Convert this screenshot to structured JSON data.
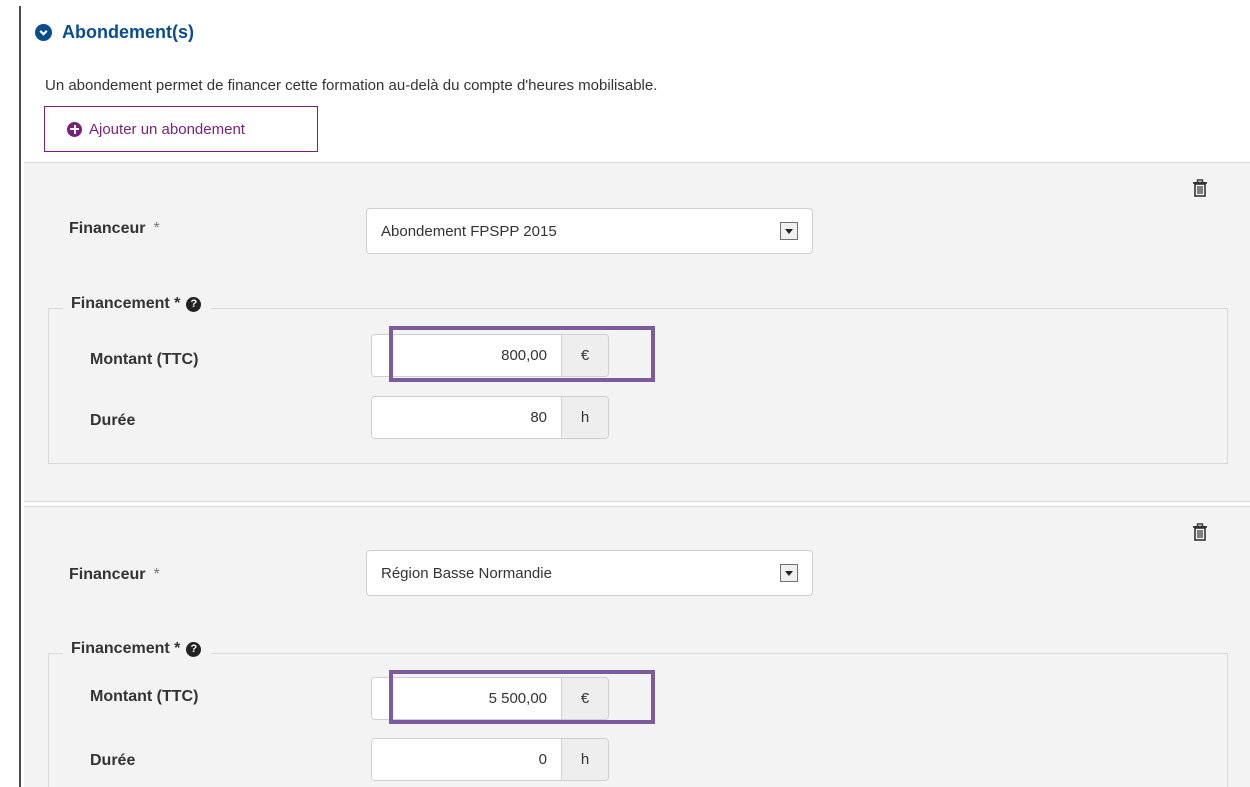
{
  "section": {
    "title": "Abondement(s)",
    "intro": "Un abondement permet de financer cette formation au-delà du compte d'heures mobilisable.",
    "add_label": "Ajouter un abondement"
  },
  "labels": {
    "financeur": "Financeur",
    "required_mark": "*",
    "financement": "Financement *",
    "montant": "Montant (TTC)",
    "duree": "Durée",
    "euro_unit": "€",
    "hour_unit": "h"
  },
  "abondements": [
    {
      "financeur": "Abondement FPSPP 2015",
      "montant": "800,00",
      "duree": "80"
    },
    {
      "financeur": "Région Basse Normandie",
      "montant": "5 500,00",
      "duree": "0"
    }
  ],
  "colors": {
    "title_blue": "#0a4c8e",
    "accent_purple": "#7a1f7a",
    "highlight": "#7b5b9b",
    "panel_bg": "#f3f3f3"
  }
}
